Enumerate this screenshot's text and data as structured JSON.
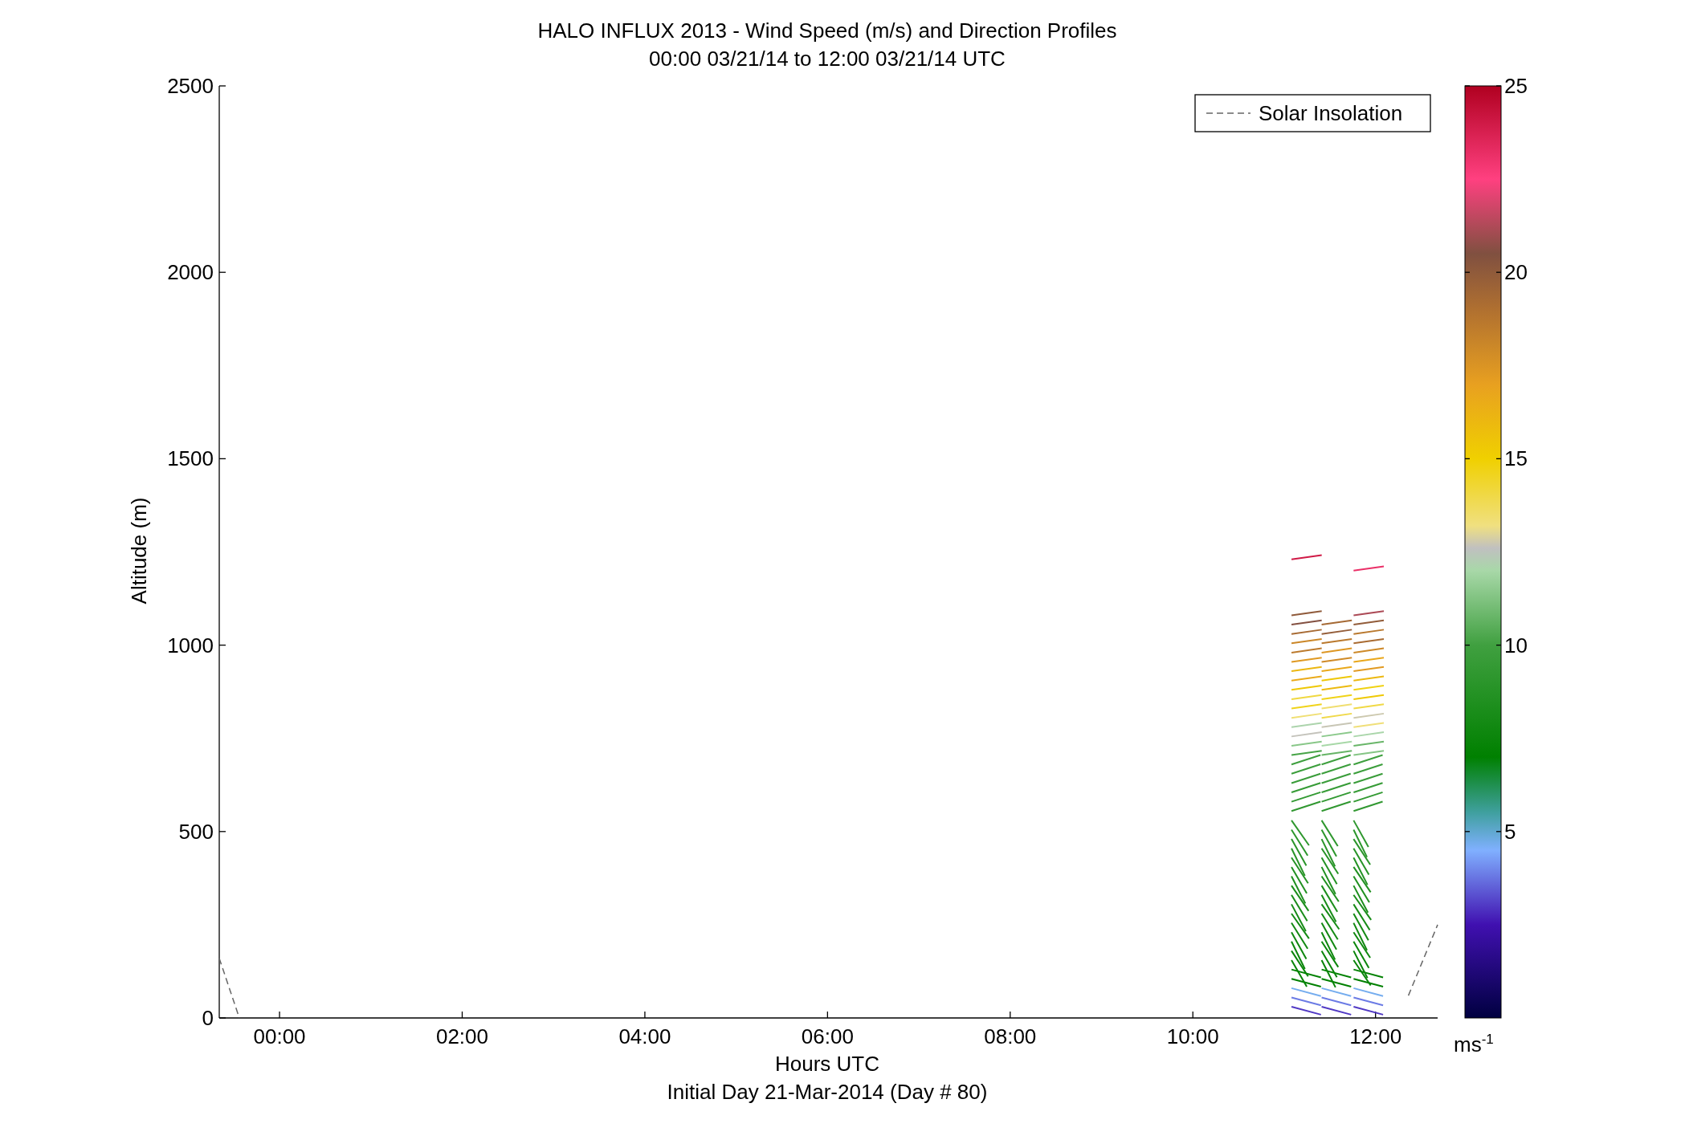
{
  "figure": {
    "title_lines": [
      "HALO INFLUX 2013 - Wind Speed (m/s) and Direction Profiles",
      "00:00 03/21/14 to 12:00 03/21/14  UTC"
    ],
    "subtitle": "Initial Day 21-Mar-2014 (Day # 80)",
    "chart_data": {
      "type": "line",
      "xlabel": "Hours UTC",
      "ylabel": "Altitude (m)",
      "xlim": [
        -0.66,
        12.68
      ],
      "ylim": [
        0,
        2500
      ],
      "xticks": [
        {
          "value": 0,
          "label": "00:00"
        },
        {
          "value": 2,
          "label": "02:00"
        },
        {
          "value": 4,
          "label": "04:00"
        },
        {
          "value": 6,
          "label": "06:00"
        },
        {
          "value": 8,
          "label": "08:00"
        },
        {
          "value": 10,
          "label": "10:00"
        },
        {
          "value": 12,
          "label": "12:00"
        }
      ],
      "yticks": [
        0,
        500,
        1000,
        1500,
        2000,
        2500
      ],
      "x": [
        -0.66,
        -0.44,
        12.0,
        12.36,
        12.68
      ],
      "series": [
        {
          "name": "Solar Insolation",
          "color": "#666666",
          "line_style": "dashed",
          "values": [
            160,
            0,
            null,
            60,
            250
          ]
        }
      ]
    },
    "colorbar": {
      "ticks": [
        "25",
        "20",
        "15",
        "10",
        "5"
      ],
      "unit": "ms$^{-1}$"
    }
  }
}
